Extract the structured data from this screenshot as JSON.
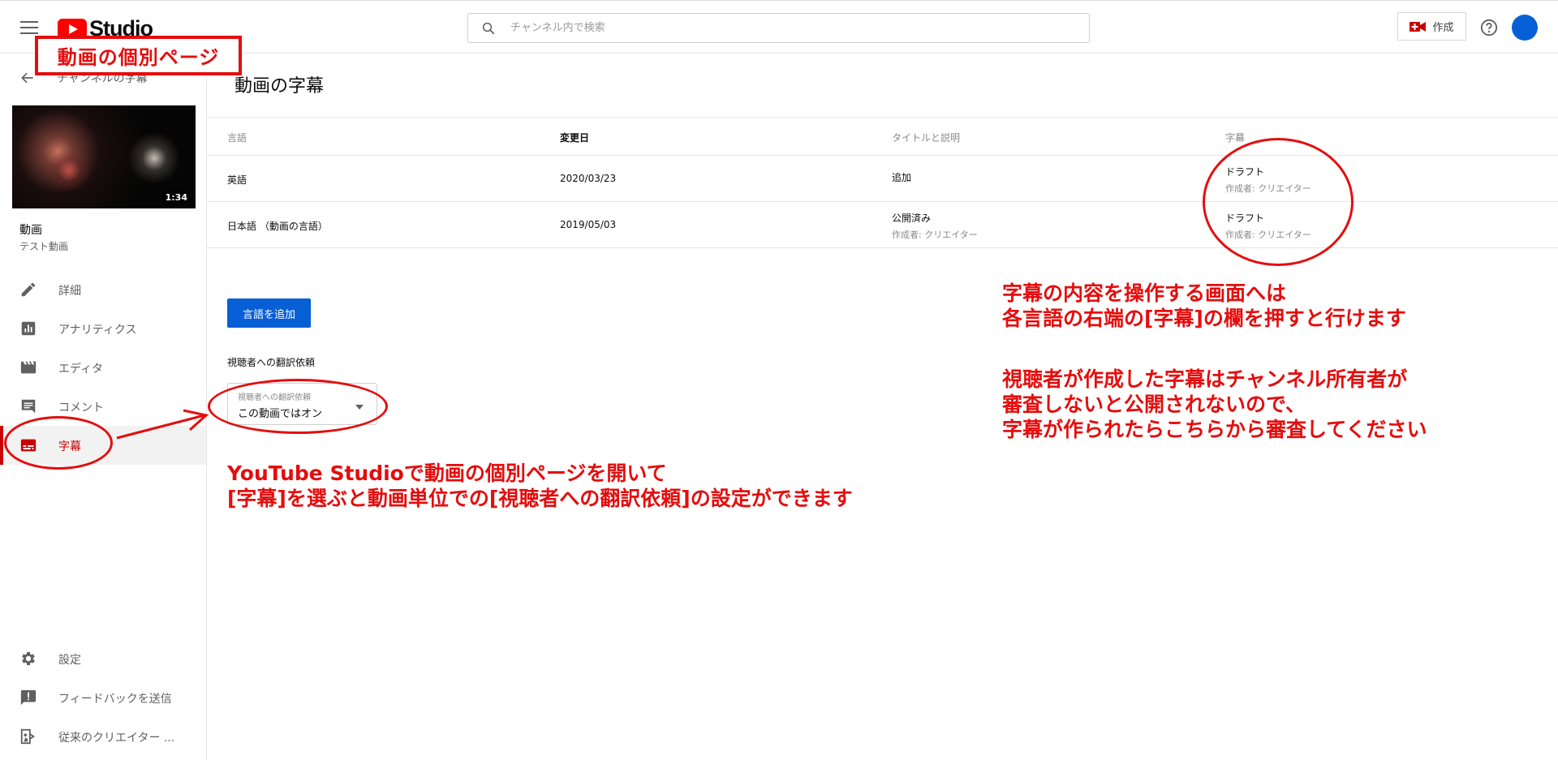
{
  "topbar": {
    "logo_text": "Studio",
    "search_placeholder": "チャンネル内で検索",
    "create_label": "作成"
  },
  "sidebar": {
    "back_label": "チャンネルの字幕",
    "video_duration": "1:34",
    "video_title": "動画",
    "video_subtitle": "テスト動画",
    "items": [
      {
        "label": "詳細",
        "icon": "pencil-icon"
      },
      {
        "label": "アナリティクス",
        "icon": "analytics-icon"
      },
      {
        "label": "エディタ",
        "icon": "clapperboard-icon"
      },
      {
        "label": "コメント",
        "icon": "comment-icon"
      },
      {
        "label": "字幕",
        "icon": "subtitles-icon",
        "active": true
      }
    ],
    "bottom_items": [
      {
        "label": "設定",
        "icon": "gear-icon"
      },
      {
        "label": "フィードバックを送信",
        "icon": "feedback-icon"
      },
      {
        "label": "従来のクリエイター ...",
        "icon": "classic-studio-icon"
      }
    ]
  },
  "main": {
    "page_title": "動画の字幕",
    "table": {
      "headers": [
        "言語",
        "変更日",
        "タイトルと説明",
        "字幕"
      ],
      "rows": [
        {
          "language": "英語",
          "date": "2020/03/23",
          "title_desc": "追加",
          "title_desc_sub": "",
          "subtitle_status": "ドラフト",
          "subtitle_author": "作成者: クリエイター"
        },
        {
          "language": "日本語 （動画の言語）",
          "date": "2019/05/03",
          "title_desc": "公開済み",
          "title_desc_sub": "作成者: クリエイター",
          "subtitle_status": "ドラフト",
          "subtitle_author": "作成者: クリエイター"
        }
      ]
    },
    "add_language_button": "言語を追加",
    "viewer_translation_label": "視聴者への翻訳依頼",
    "viewer_select": {
      "label": "視聴者への翻訳依頼",
      "value": "この動画ではオン"
    }
  },
  "annotations": {
    "box_title": "動画の個別ページ",
    "note_right_1": [
      "字幕の内容を操作する画面へは",
      "各言語の右端の[字幕]の欄を押すと行けます"
    ],
    "note_right_2": [
      "視聴者が作成した字幕はチャンネル所有者が",
      "審査しないと公開されないので、",
      "字幕が作られたらこちらから審査してください"
    ],
    "note_bottom": [
      "YouTube Studioで動画の個別ページを開いて",
      "[字幕]を選ぶと動画単位での[視聴者への翻訳依頼]の設定ができます"
    ]
  },
  "colors": {
    "accent_blue": "#065fd4",
    "brand_red": "#ff0000",
    "annotation_red": "#e50d0d",
    "active_nav_red": "#cc0000"
  }
}
